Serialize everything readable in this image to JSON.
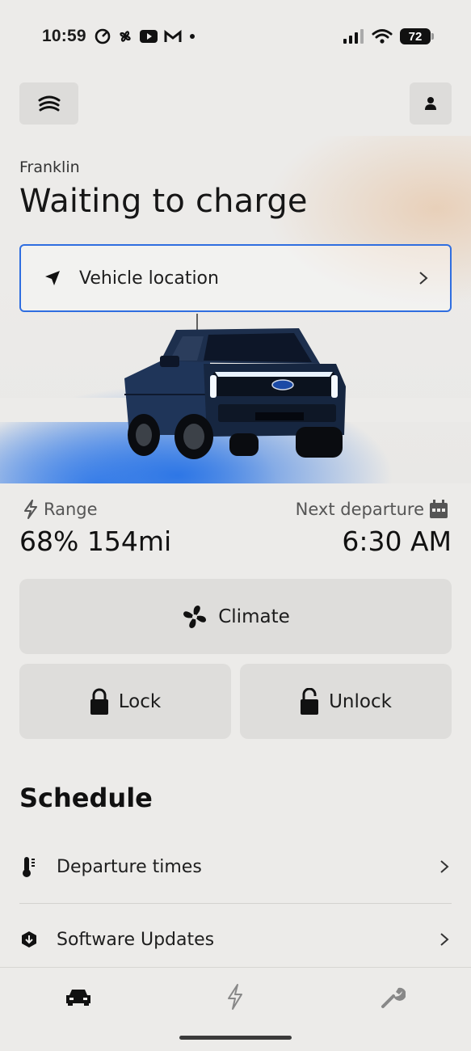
{
  "status_bar": {
    "time": "10:59",
    "battery": "72",
    "icons": [
      "timer-icon",
      "pinwheel-icon",
      "youtube-icon",
      "gmail-icon",
      "dot-icon",
      "signal-icon",
      "wifi-icon",
      "battery-icon"
    ]
  },
  "header": {
    "left_button_icon": "garage-icon",
    "right_button_icon": "profile-icon"
  },
  "vehicle": {
    "name": "Franklin",
    "status_title": "Waiting to charge"
  },
  "location": {
    "label": "Vehicle location",
    "icon": "navigation-arrow-icon"
  },
  "range": {
    "label": "Range",
    "value": "68% 154mi",
    "icon": "bolt-icon"
  },
  "departure": {
    "label": "Next departure",
    "value": "6:30 AM",
    "icon": "calendar-icon"
  },
  "actions": {
    "climate": "Climate",
    "lock": "Lock",
    "unlock": "Unlock"
  },
  "schedule": {
    "title": "Schedule",
    "items": [
      {
        "label": "Departure times",
        "icon": "thermometer-icon"
      },
      {
        "label": "Software Updates",
        "icon": "download-hex-icon"
      }
    ]
  },
  "tabbar": {
    "tabs": [
      {
        "name": "vehicle",
        "icon": "car-icon"
      },
      {
        "name": "charging",
        "icon": "bolt-icon"
      },
      {
        "name": "service",
        "icon": "wrench-icon"
      }
    ]
  },
  "colors": {
    "accent_blue": "#2f6ee0",
    "background": "#ecebe9",
    "button_bg": "#dedddb"
  }
}
